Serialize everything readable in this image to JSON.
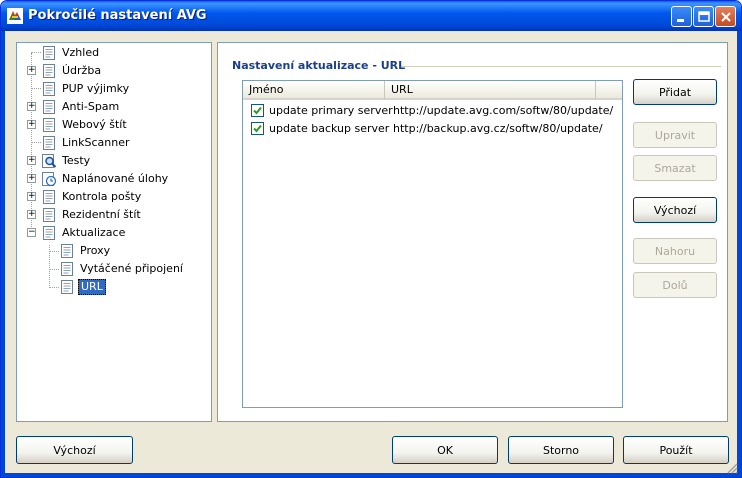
{
  "window": {
    "title": "Pokročilé nastavení AVG"
  },
  "tree": {
    "items": [
      {
        "label": "Vzhled",
        "icon": "document-icon"
      },
      {
        "label": "Údržba",
        "icon": "document-icon"
      },
      {
        "label": "PUP výjimky",
        "icon": "document-icon"
      },
      {
        "label": "Anti-Spam",
        "icon": "document-icon"
      },
      {
        "label": "Webový štít",
        "icon": "document-icon"
      },
      {
        "label": "LinkScanner",
        "icon": "document-icon"
      },
      {
        "label": "Testy",
        "icon": "magnifier-icon"
      },
      {
        "label": "Naplánované úlohy",
        "icon": "clock-icon"
      },
      {
        "label": "Kontrola pošty",
        "icon": "document-icon"
      },
      {
        "label": "Rezidentní štít",
        "icon": "document-icon"
      },
      {
        "label": "Aktualizace",
        "icon": "document-icon"
      },
      {
        "label": "Proxy",
        "icon": "document-icon"
      },
      {
        "label": "Vytáčené připojení",
        "icon": "document-icon"
      },
      {
        "label": "URL",
        "icon": "document-icon"
      }
    ]
  },
  "section": {
    "title": "Nastavení aktualizace - URL"
  },
  "table": {
    "columns": [
      "Jméno",
      "URL"
    ],
    "rows": [
      {
        "checked": true,
        "name": "update primary server",
        "url": "http://update.avg.com/softw/80/update/"
      },
      {
        "checked": true,
        "name": "update backup server",
        "url": "http://backup.avg.cz/softw/80/update/"
      }
    ]
  },
  "side_buttons": {
    "add": "Přidat",
    "edit": "Upravit",
    "delete": "Smazat",
    "default": "Výchozí",
    "up": "Nahoru",
    "down": "Dolů"
  },
  "bottom_buttons": {
    "default": "Výchozí",
    "ok": "OK",
    "cancel": "Storno",
    "apply": "Použít"
  },
  "colors": {
    "titlebar": "#0058ee",
    "selection": "#316ac5",
    "section_title": "#1a3f8c"
  }
}
